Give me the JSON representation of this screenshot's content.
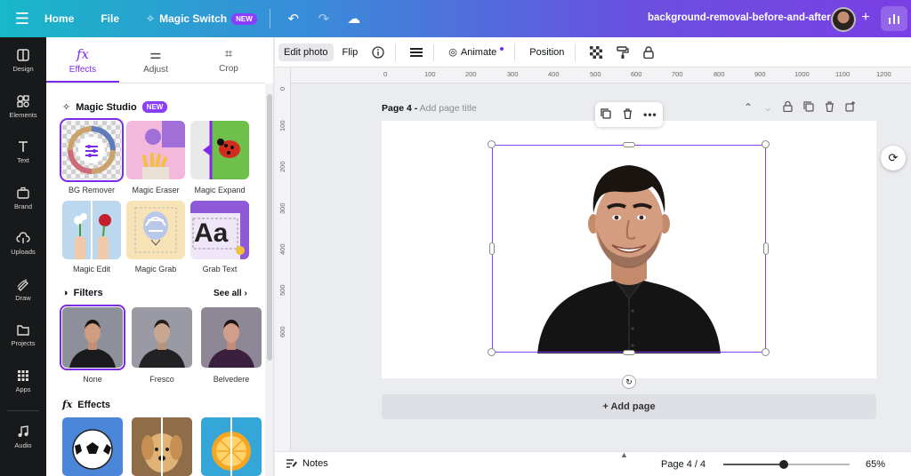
{
  "topbar": {
    "home": "Home",
    "file": "File",
    "magic_switch": "Magic Switch",
    "magic_badge": "NEW",
    "doc_title": "background-removal-before-and-after"
  },
  "rail": [
    {
      "label": "Design",
      "icon": "layout-icon"
    },
    {
      "label": "Elements",
      "icon": "shapes-icon"
    },
    {
      "label": "Text",
      "icon": "text-icon"
    },
    {
      "label": "Brand",
      "icon": "briefcase-icon"
    },
    {
      "label": "Uploads",
      "icon": "cloud-upload-icon"
    },
    {
      "label": "Draw",
      "icon": "pen-icon"
    },
    {
      "label": "Projects",
      "icon": "folder-icon"
    },
    {
      "label": "Apps",
      "icon": "grid-icon"
    },
    {
      "label": "Audio",
      "icon": "music-icon"
    }
  ],
  "panel": {
    "tabs": [
      "Effects",
      "Adjust",
      "Crop"
    ],
    "tab_icons": [
      "fx",
      "⚌",
      "⌗"
    ],
    "magic_studio": "Magic Studio",
    "magic_studio_badge": "NEW",
    "tools": [
      "BG Remover",
      "Magic Eraser",
      "Magic Expand",
      "Magic Edit",
      "Magic Grab",
      "Grab Text"
    ],
    "grab_text_sample": "Aa",
    "filters": "Filters",
    "see_all": "See all",
    "filter_items": [
      "None",
      "Fresco",
      "Belvedere"
    ],
    "effects": "Effects",
    "effects_icon": "fx"
  },
  "toolbar": {
    "edit_photo": "Edit photo",
    "flip": "Flip",
    "animate": "Animate",
    "position": "Position"
  },
  "rulers": {
    "h": [
      "0",
      "100",
      "200",
      "300",
      "400",
      "500",
      "600",
      "700",
      "800",
      "900",
      "1000",
      "1100",
      "1200"
    ],
    "v": [
      "0",
      "100",
      "200",
      "300",
      "400",
      "500",
      "600"
    ]
  },
  "canvas": {
    "page_label": "Page 4 -",
    "page_title_placeholder": "Add page title",
    "add_page": "+ Add page"
  },
  "bottombar": {
    "notes": "Notes",
    "page_count": "Page 4 / 4",
    "zoom": "65%",
    "zoom_fraction": 0.48
  },
  "colors": {
    "accent": "#7d2ae8",
    "rail_bg": "#18191b",
    "canvas_bg": "#ebecf0"
  }
}
